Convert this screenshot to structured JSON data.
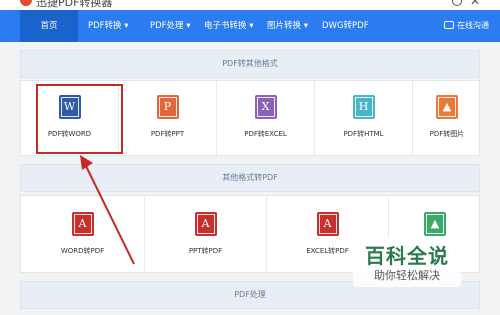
{
  "app": {
    "brand": "迅捷PDF转换器"
  },
  "nav": {
    "items": [
      {
        "label": "首页",
        "active": true
      },
      {
        "label": "PDF转换 ▾"
      },
      {
        "label": "PDF处理 ▾"
      },
      {
        "label": "电子书转换 ▾"
      },
      {
        "label": "图片转换 ▾"
      },
      {
        "label": "DWG转PDF"
      }
    ],
    "right_label": "在线沟通"
  },
  "sections": {
    "pdf_to_other": {
      "title": "PDF转其他格式",
      "items": [
        {
          "label": "PDF转WORD",
          "icon": "word-icon",
          "glyph": "W",
          "color": "#2f5ba8"
        },
        {
          "label": "PDF转PPT",
          "icon": "ppt-icon",
          "glyph": "P",
          "color": "#e0683a"
        },
        {
          "label": "PDF转EXCEL",
          "icon": "excel-icon",
          "glyph": "X",
          "color": "#8a62b8"
        },
        {
          "label": "PDF转HTML",
          "icon": "html-icon",
          "glyph": "H",
          "color": "#4bb4c8"
        },
        {
          "label": "PDF转图片",
          "icon": "image-icon",
          "glyph": "▲",
          "color": "#e87a3c"
        }
      ]
    },
    "other_to_pdf": {
      "title": "其他格式转PDF",
      "items": [
        {
          "label": "WORD转PDF",
          "icon": "pdf-icon",
          "glyph": "A",
          "color": "#c9302c"
        },
        {
          "label": "PPT转PDF",
          "icon": "pdf-icon",
          "glyph": "A",
          "color": "#c9302c"
        },
        {
          "label": "EXCEL转PDF",
          "icon": "pdf-icon",
          "glyph": "A",
          "color": "#c9302c"
        },
        {
          "label": "",
          "icon": "image-icon",
          "glyph": "▲",
          "color": "#3daa6a"
        }
      ]
    },
    "pdf_process": {
      "title": "PDF处理"
    }
  },
  "watermark": {
    "title": "百科全说",
    "subtitle": "助你轻松解决"
  }
}
